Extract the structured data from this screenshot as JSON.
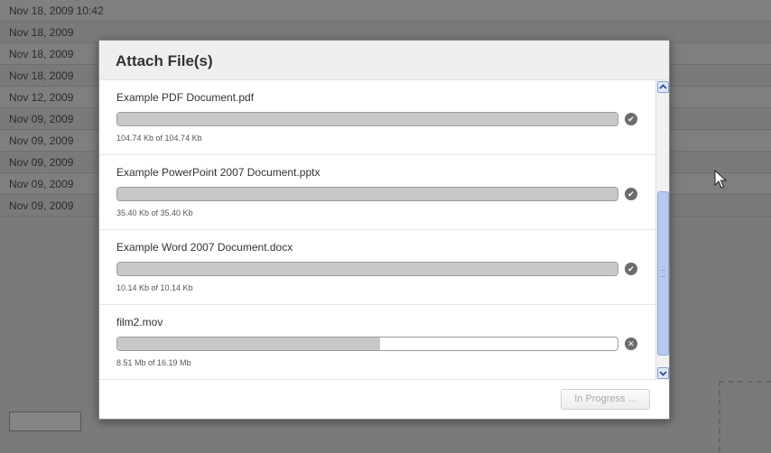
{
  "background": {
    "rows": [
      "Nov 18, 2009 10:42",
      "Nov 18, 2009",
      "Nov 18, 2009",
      "Nov 18, 2009",
      "Nov 12, 2009",
      "Nov 09, 2009",
      "Nov 09, 2009",
      "Nov 09, 2009",
      "Nov 09, 2009",
      "Nov 09, 2009"
    ]
  },
  "dialog": {
    "title": "Attach File(s)",
    "files": [
      {
        "name": "Example PDF Document.pdf",
        "size_text": "104.74 Kb of 104.74 Kb",
        "progress": 1.0,
        "status_icon": "check-icon"
      },
      {
        "name": "Example PowerPoint 2007 Document.pptx",
        "size_text": "35.40 Kb of 35.40 Kb",
        "progress": 1.0,
        "status_icon": "check-icon"
      },
      {
        "name": "Example Word 2007 Document.docx",
        "size_text": "10.14 Kb of 10.14 Kb",
        "progress": 1.0,
        "status_icon": "check-icon"
      },
      {
        "name": "film2.mov",
        "size_text": "8.51 Mb of 16.19 Mb",
        "progress": 0.526,
        "status_icon": "cancel-icon"
      }
    ],
    "footer_button": "In Progress ..."
  },
  "colors": {
    "overlay": "#7a7a7a",
    "progress_fill": "#c8c8c8",
    "scroll_thumb": "#b7c9ee"
  }
}
